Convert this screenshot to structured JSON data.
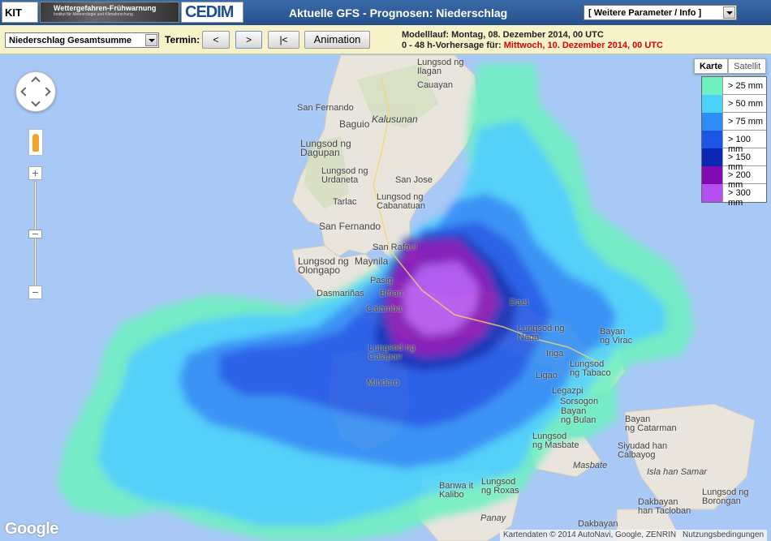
{
  "header": {
    "kit_logo": "KIT",
    "wfw_title": "Wettergefahren-Frühwarnung",
    "wfw_subtitle": "Institut für Meteorologie und Klimaforschung",
    "cedim_logo": "CEDIM",
    "title": "Aktuelle GFS - Prognosen: Niederschlag",
    "param_select": "[ Weitere Parameter / Info ]"
  },
  "toolbar": {
    "product_select": "Niederschlag Gesamtsumme",
    "termin_label": "Termin:",
    "prev_label": "<",
    "next_label": ">",
    "first_label": "|<",
    "animation_label": "Animation",
    "run_line": "Modelllauf: Montag, 08. Dezember 2014, 00 UTC",
    "forecast_prefix": "0 - 48 h-Vorhersage für:",
    "forecast_date": "Mittwoch, 10. Dezember 2014, 00 UTC"
  },
  "map": {
    "type_karte": "Karte",
    "type_satellit": "Satellit",
    "zoom_in": "+",
    "zoom_out": "−",
    "google_logo": "Google",
    "attribution": "Kartendaten © 2014 AutoNavi, Google, ZENRIN",
    "terms": "Nutzungsbedingungen",
    "legend": [
      {
        "label": "> 25 mm",
        "color": "#6ef0c0"
      },
      {
        "label": "> 50 mm",
        "color": "#4ad2fa"
      },
      {
        "label": "> 75 mm",
        "color": "#2e8cf5"
      },
      {
        "label": "> 100 mm",
        "color": "#1c54e6"
      },
      {
        "label": "> 150 mm",
        "color": "#0a28b4"
      },
      {
        "label": "> 200 mm",
        "color": "#820ab4"
      },
      {
        "label": "> 300 mm",
        "color": "#b450f0"
      }
    ],
    "places": {
      "p1": "Lungsod ng",
      "p1b": "Ilagan",
      "p2": "Cauayan",
      "p3": "San Fernando",
      "p4": "Baguio",
      "p5": "Kalusunan",
      "p6": "Lungsod ng",
      "p6b": "Dagupan",
      "p7": "Lungsod ng",
      "p7b": "Urdaneta",
      "p8": "San Jose",
      "p9": "Tarlac",
      "p10": "Lungsod ng",
      "p10b": "Cabanatuan",
      "p11": "San Fernando",
      "p12": "San Rafael",
      "p13": "Lungsod ng",
      "p13b": "Olongapo",
      "p14": "Maynila",
      "p15": "Pasig",
      "p16": "Dasmariñas",
      "p17": "Biñan",
      "p18": "Calamba",
      "p19": "Daet",
      "p20": "Lungsod ng",
      "p20b": "Naga",
      "p21": "Bayan",
      "p21b": "ng Virac",
      "p22": "Lungsod ng",
      "p22b": "Calapan",
      "p23": "Iriga",
      "p24": "Mindoro",
      "p25": "Ligao",
      "p26": "Lungsod",
      "p26b": "ng Tabaco",
      "p27": "Legazpi",
      "p28": "Sorsogon",
      "p29": "Bayan",
      "p29b": "ng Bulan",
      "p30": "Bayan",
      "p30b": "ng Catarman",
      "p31": "Lungsod",
      "p31b": "ng Masbate",
      "p32": "Masbate",
      "p33": "Siyudad han",
      "p33b": "Calbayog",
      "p34": "Isla han Samar",
      "p35": "Lungsod",
      "p35b": "ng Roxas",
      "p36": "Banwa it",
      "p36b": "Kalibo",
      "p37": "Panay",
      "p38": "Lungsod ng",
      "p38b": "Borongan",
      "p39": "Dakbayan",
      "p39b": "han Tacloban",
      "p40": "Dakbayan"
    }
  }
}
